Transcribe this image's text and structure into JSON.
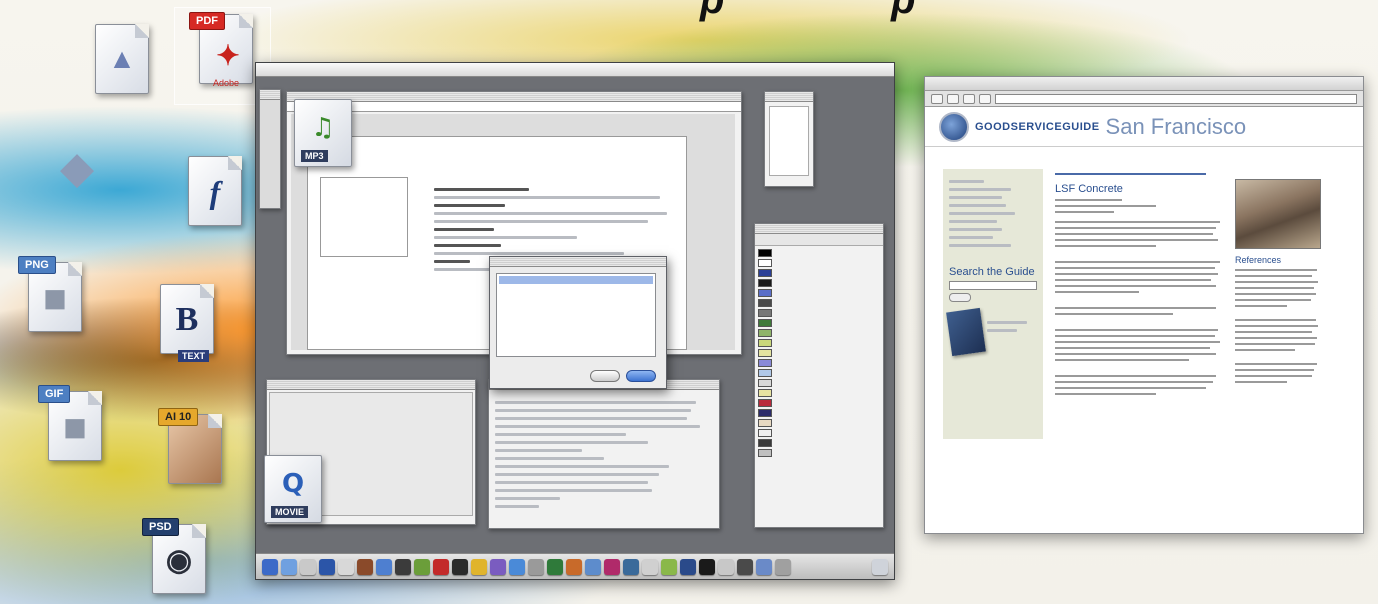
{
  "desktop_icons": [
    {
      "name": "image-file-icon",
      "tag": "",
      "glyph": ""
    },
    {
      "name": "pdf-file-icon",
      "tag": "PDF",
      "sub": "Adobe"
    },
    {
      "name": "cad-file-icon",
      "tag": "",
      "glyph": ""
    },
    {
      "name": "flash-file-icon",
      "tag": "",
      "glyph": "f"
    },
    {
      "name": "png-file-icon",
      "tag": "PNG",
      "glyph": ""
    },
    {
      "name": "bbedit-text-file-icon",
      "tag": "",
      "glyph": "B",
      "sub": "TEXT"
    },
    {
      "name": "gif-file-icon",
      "tag": "GIF",
      "glyph": ""
    },
    {
      "name": "illustrator-file-icon",
      "tag": "AI 10",
      "glyph": ""
    },
    {
      "name": "psd-file-icon",
      "tag": "PSD",
      "glyph": ""
    }
  ],
  "mac_screen": {
    "overlay_icons": {
      "mp3": {
        "label": "MP3",
        "symbol": "♫"
      },
      "movie": {
        "label": "MOVIE",
        "symbol": "Q"
      }
    }
  },
  "browser": {
    "site_name": "GOODSERVICEGUIDE",
    "city": "San Francisco",
    "search_title": "Search the Guide",
    "article_title": "LSF Concrete",
    "references_title": "References"
  },
  "colors": {
    "site_blue": "#2a4f8f",
    "sidebar_bg": "#e6e8d8"
  }
}
